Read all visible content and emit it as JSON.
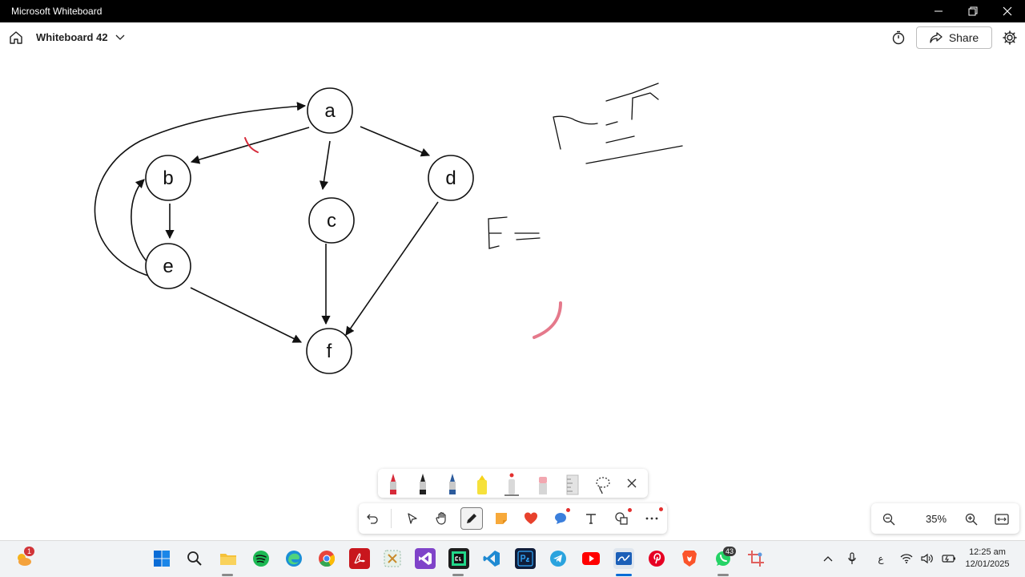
{
  "window": {
    "title": "Microsoft Whiteboard"
  },
  "header": {
    "board_name": "Whiteboard 42",
    "share_label": "Share"
  },
  "graph": {
    "nodes": [
      {
        "id": "a",
        "label": "a"
      },
      {
        "id": "b",
        "label": "b"
      },
      {
        "id": "c",
        "label": "c"
      },
      {
        "id": "d",
        "label": "d"
      },
      {
        "id": "e",
        "label": "e"
      },
      {
        "id": "f",
        "label": "f"
      }
    ]
  },
  "zoom": {
    "level": "35%"
  },
  "taskbar": {
    "widgets_badge": "1",
    "whatsapp_badge": "43",
    "clock_time": "12:25 am",
    "clock_date": "12/01/2025",
    "input_indicator": "ع"
  },
  "colors": {
    "accent": "#e3302f",
    "ink": "#111111",
    "taskbar_bg": "#f1f3f5"
  },
  "icons": [
    "home-icon",
    "chevron-down-icon",
    "timer-icon",
    "share-icon",
    "gear-icon",
    "undo-icon",
    "select-icon",
    "hand-icon",
    "pen-icon",
    "sticky-note-icon",
    "reaction-icon",
    "comment-icon",
    "text-icon",
    "shapes-icon",
    "more-icon",
    "zoom-out-icon",
    "zoom-in-icon",
    "fit-icon"
  ]
}
